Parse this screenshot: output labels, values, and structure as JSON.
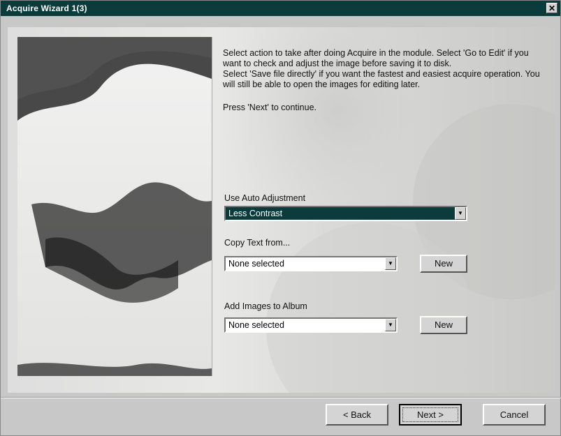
{
  "window": {
    "title": "Acquire Wizard 1(3)",
    "close_glyph": "✕"
  },
  "description": {
    "line1": "Select action to take after doing Acquire in the module. Select 'Go to Edit' if you want to check and adjust the image before saving it to disk.",
    "line2": "Select 'Save file directly' if you want the fastest and easiest acquire operation. You will still be able to open the images for editing later.",
    "press": "Press 'Next' to continue."
  },
  "auto_adjust": {
    "label": "Use Auto Adjustment",
    "value": "Less Contrast"
  },
  "copy_text": {
    "label": "Copy Text from...",
    "value": "None selected",
    "new_label": "New"
  },
  "album": {
    "label": "Add Images to Album",
    "value": "None selected",
    "new_label": "New"
  },
  "footer": {
    "back_label": "< Back",
    "next_label": "Next >",
    "cancel_label": "Cancel"
  },
  "icons": {
    "dropdown": "chevron-down-icon",
    "close": "close-icon"
  }
}
